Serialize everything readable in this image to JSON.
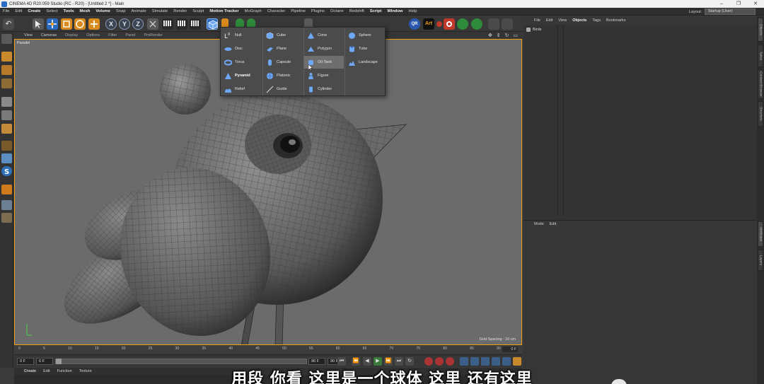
{
  "window": {
    "title": "CINEMA 4D R20.059 Studio (RC - R20) - [Untitled 2 *] - Main",
    "controls": [
      "–",
      "❐",
      "✕"
    ]
  },
  "menubar": {
    "items": [
      "File",
      "Edit",
      "Create",
      "Select",
      "Tools",
      "Mesh",
      "Volume",
      "Snap",
      "Animate",
      "Simulate",
      "Render",
      "Sculpt",
      "Motion Tracker",
      "MoGraph",
      "Character",
      "Pipeline",
      "Plugins",
      "Octane",
      "Redshift",
      "Script",
      "Window",
      "Help"
    ],
    "bold_items": [
      "Create",
      "Tools",
      "Mesh",
      "Volume",
      "Motion Tracker",
      "Script",
      "Window"
    ],
    "layout_label": "Layout:",
    "layout_value": "Startup (User)"
  },
  "toolbar": {
    "undo_glyph": "↶",
    "xyz": [
      "X",
      "Y",
      "Z"
    ],
    "qr_label": "QR",
    "art_label": "Art"
  },
  "viewport": {
    "menu": [
      "View",
      "Cameras",
      "Display",
      "Options",
      "Filter",
      "Panel",
      "ProRender"
    ],
    "projection": "Parallel",
    "grid_spacing": "Grid Spacing : 10 cm",
    "nav_glyphs": "✥ ⇕ ↻ ▭"
  },
  "timeline": {
    "ticks": [
      "0",
      "5",
      "10",
      "15",
      "20",
      "25",
      "30",
      "35",
      "40",
      "45",
      "50",
      "55",
      "60",
      "65",
      "70",
      "75",
      "80",
      "85",
      "90"
    ],
    "current": "0 F"
  },
  "playback": {
    "start_frame": "0 F",
    "min_frame": "0 F",
    "end_frame": "90 F",
    "max_frame": "90 F",
    "buttons": [
      "⏮",
      "⏪",
      "◀",
      "▶",
      "⏩",
      "⏭",
      "↻"
    ]
  },
  "bottom_panel": {
    "menu": [
      "Create",
      "Edit",
      "Function",
      "Texture"
    ]
  },
  "object_manager": {
    "menu": [
      "File",
      "Edit",
      "View",
      "Objects",
      "Tags",
      "Bookmarks"
    ],
    "bold_items": [
      "Objects"
    ],
    "root_object": "Birds"
  },
  "attribute_manager": {
    "menu": [
      "Mode",
      "Edit"
    ]
  },
  "side_tabs": [
    "Objects",
    "Takes",
    "Content Browser",
    "Structure",
    "Attributes",
    "Layers"
  ],
  "create_menu": {
    "items": [
      {
        "label": "Null",
        "icon": "null-icon",
        "bold": false
      },
      {
        "label": "Disc",
        "icon": "disc-icon",
        "bold": false
      },
      {
        "label": "Torus",
        "icon": "torus-icon",
        "bold": false
      },
      {
        "label": "Pyramid",
        "icon": "pyramid-icon",
        "bold": true
      },
      {
        "label": "Relief",
        "icon": "relief-icon",
        "bold": false
      },
      {
        "label": "Cube",
        "icon": "cube-icon",
        "bold": false
      },
      {
        "label": "Plane",
        "icon": "plane-icon",
        "bold": false
      },
      {
        "label": "Capsule",
        "icon": "capsule-icon",
        "bold": false
      },
      {
        "label": "Platonic",
        "icon": "platonic-icon",
        "bold": false
      },
      {
        "label": "Guide",
        "icon": "guide-icon",
        "bold": false
      },
      {
        "label": "Cone",
        "icon": "cone-icon",
        "bold": false
      },
      {
        "label": "Polygon",
        "icon": "polygon-icon",
        "bold": false
      },
      {
        "label": "Oil-Tank",
        "icon": "oil-tank-icon",
        "bold": false
      },
      {
        "label": "Figure",
        "icon": "figure-icon",
        "bold": false
      },
      {
        "label": "Cylinder",
        "icon": "cylinder-icon",
        "bold": false
      },
      {
        "label": "Sphere",
        "icon": "sphere-icon",
        "bold": false
      },
      {
        "label": "Tube",
        "icon": "tube-icon",
        "bold": false
      },
      {
        "label": "Landscape",
        "icon": "landscape-icon",
        "bold": false
      }
    ],
    "hovered": "Oil-Tank"
  },
  "subtitle": "用段 你看 这里是一个球体 这里 还有这里",
  "colors": {
    "accent_blue": "#2c6ac0",
    "viewport_border": "#f39c12",
    "viewport_bg": "#6b6b6b",
    "panel_bg": "#333333"
  }
}
